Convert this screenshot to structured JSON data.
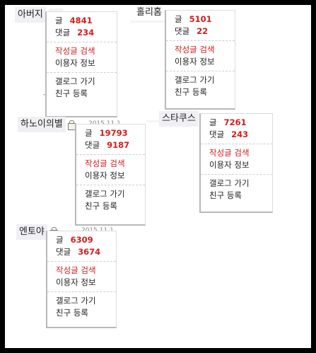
{
  "cards": [
    {
      "nickname": "아버지",
      "post_label": "글",
      "post_count": "4841",
      "comment_label": "댓글",
      "comment_count": "234",
      "search_label": "작성글 검색",
      "info_label": "이용자 정보",
      "gallog_label": "갤로그 가기",
      "friend_label": "친구 등록"
    },
    {
      "nickname": "홀리홈",
      "post_label": "글",
      "post_count": "5101",
      "comment_label": "댓글",
      "comment_count": "22",
      "search_label": "작성글 검색",
      "info_label": "이용자 정보",
      "gallog_label": "갤로그 가기",
      "friend_label": "친구 등록"
    },
    {
      "nickname": "하노이의별",
      "date": "2015.11.1",
      "post_label": "글",
      "post_count": "19793",
      "comment_label": "댓글",
      "comment_count": "9187",
      "search_label": "작성글 검색",
      "info_label": "이용자 정보",
      "gallog_label": "갤로그 가기",
      "friend_label": "친구 등록"
    },
    {
      "nickname": "스타쿠스",
      "post_label": "글",
      "post_count": "7261",
      "comment_label": "댓글",
      "comment_count": "243",
      "search_label": "작성글 검색",
      "info_label": "이용자 정보",
      "gallog_label": "갤로그 가기",
      "friend_label": "친구 등록"
    },
    {
      "nickname": "엔토야",
      "date": "2015.11.1",
      "post_label": "글",
      "post_count": "6309",
      "comment_label": "댓글",
      "comment_count": "3674",
      "search_label": "작성글 검색",
      "info_label": "이용자 정보",
      "gallog_label": "갤로그 가기",
      "friend_label": "친구 등록"
    }
  ],
  "colors": {
    "count": "#d41c1c",
    "search": "#d41c1c",
    "frame": "#000000"
  }
}
